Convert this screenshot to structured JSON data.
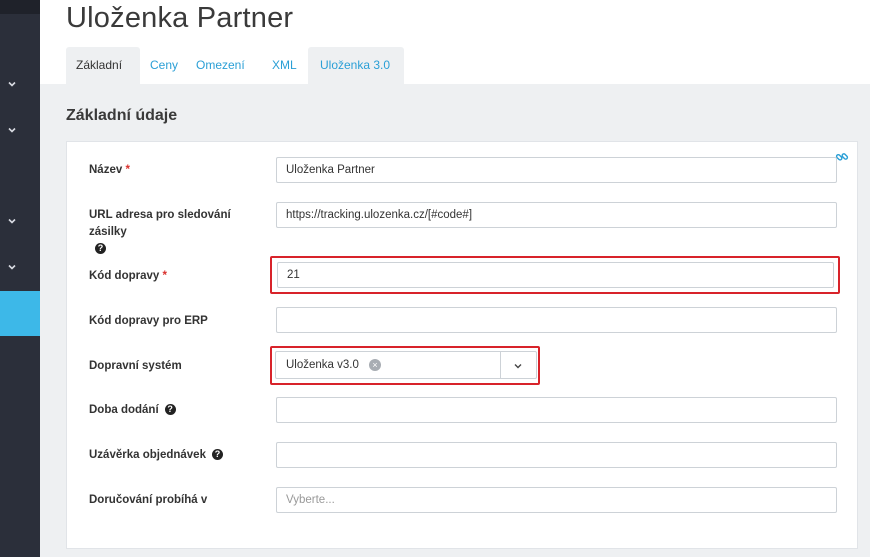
{
  "page": {
    "title": "Uloženka Partner"
  },
  "tabs": [
    {
      "label": "Základní",
      "active": true
    },
    {
      "label": "Ceny",
      "active": false
    },
    {
      "label": "Omezení",
      "active": false
    },
    {
      "label": "XML",
      "active": false
    },
    {
      "label": "Uloženka 3.0",
      "active": false
    }
  ],
  "section": {
    "title": "Základní údaje"
  },
  "form": {
    "name": {
      "label": "Název",
      "value": "Uloženka Partner",
      "required": true
    },
    "tracking_url": {
      "label": "URL adresa pro sledování zásilky",
      "value": "https://tracking.ulozenka.cz/[#code#]",
      "help": true
    },
    "shipping_code": {
      "label": "Kód dopravy",
      "value": "21",
      "required": true
    },
    "erp_code": {
      "label": "Kód dopravy pro ERP",
      "value": ""
    },
    "shipping_system": {
      "label": "Dopravní systém",
      "selected": "Uloženka v3.0"
    },
    "delivery_time": {
      "label": "Doba dodání",
      "value": "",
      "help": true
    },
    "order_cutoff": {
      "label": "Uzávěrka objednávek",
      "value": "",
      "help": true
    },
    "delivery_on": {
      "label": "Doručování probíhá v",
      "placeholder": "Vyberte..."
    }
  },
  "icons": {
    "sidebar_chevrons": [
      "chevron-down-icon",
      "chevron-down-icon",
      "chevron-down-icon",
      "chevron-down-icon"
    ],
    "link": "link-icon",
    "help": "question-circle-icon",
    "clear": "clear-icon",
    "dropdown": "chevron-down-icon"
  },
  "colors": {
    "sidebar": "#2b2f3a",
    "sidebar_active": "#3db8e8",
    "link": "#2a9fd6",
    "required": "#d9302c",
    "highlight": "#d8232a",
    "panel": "#eef0f2"
  }
}
